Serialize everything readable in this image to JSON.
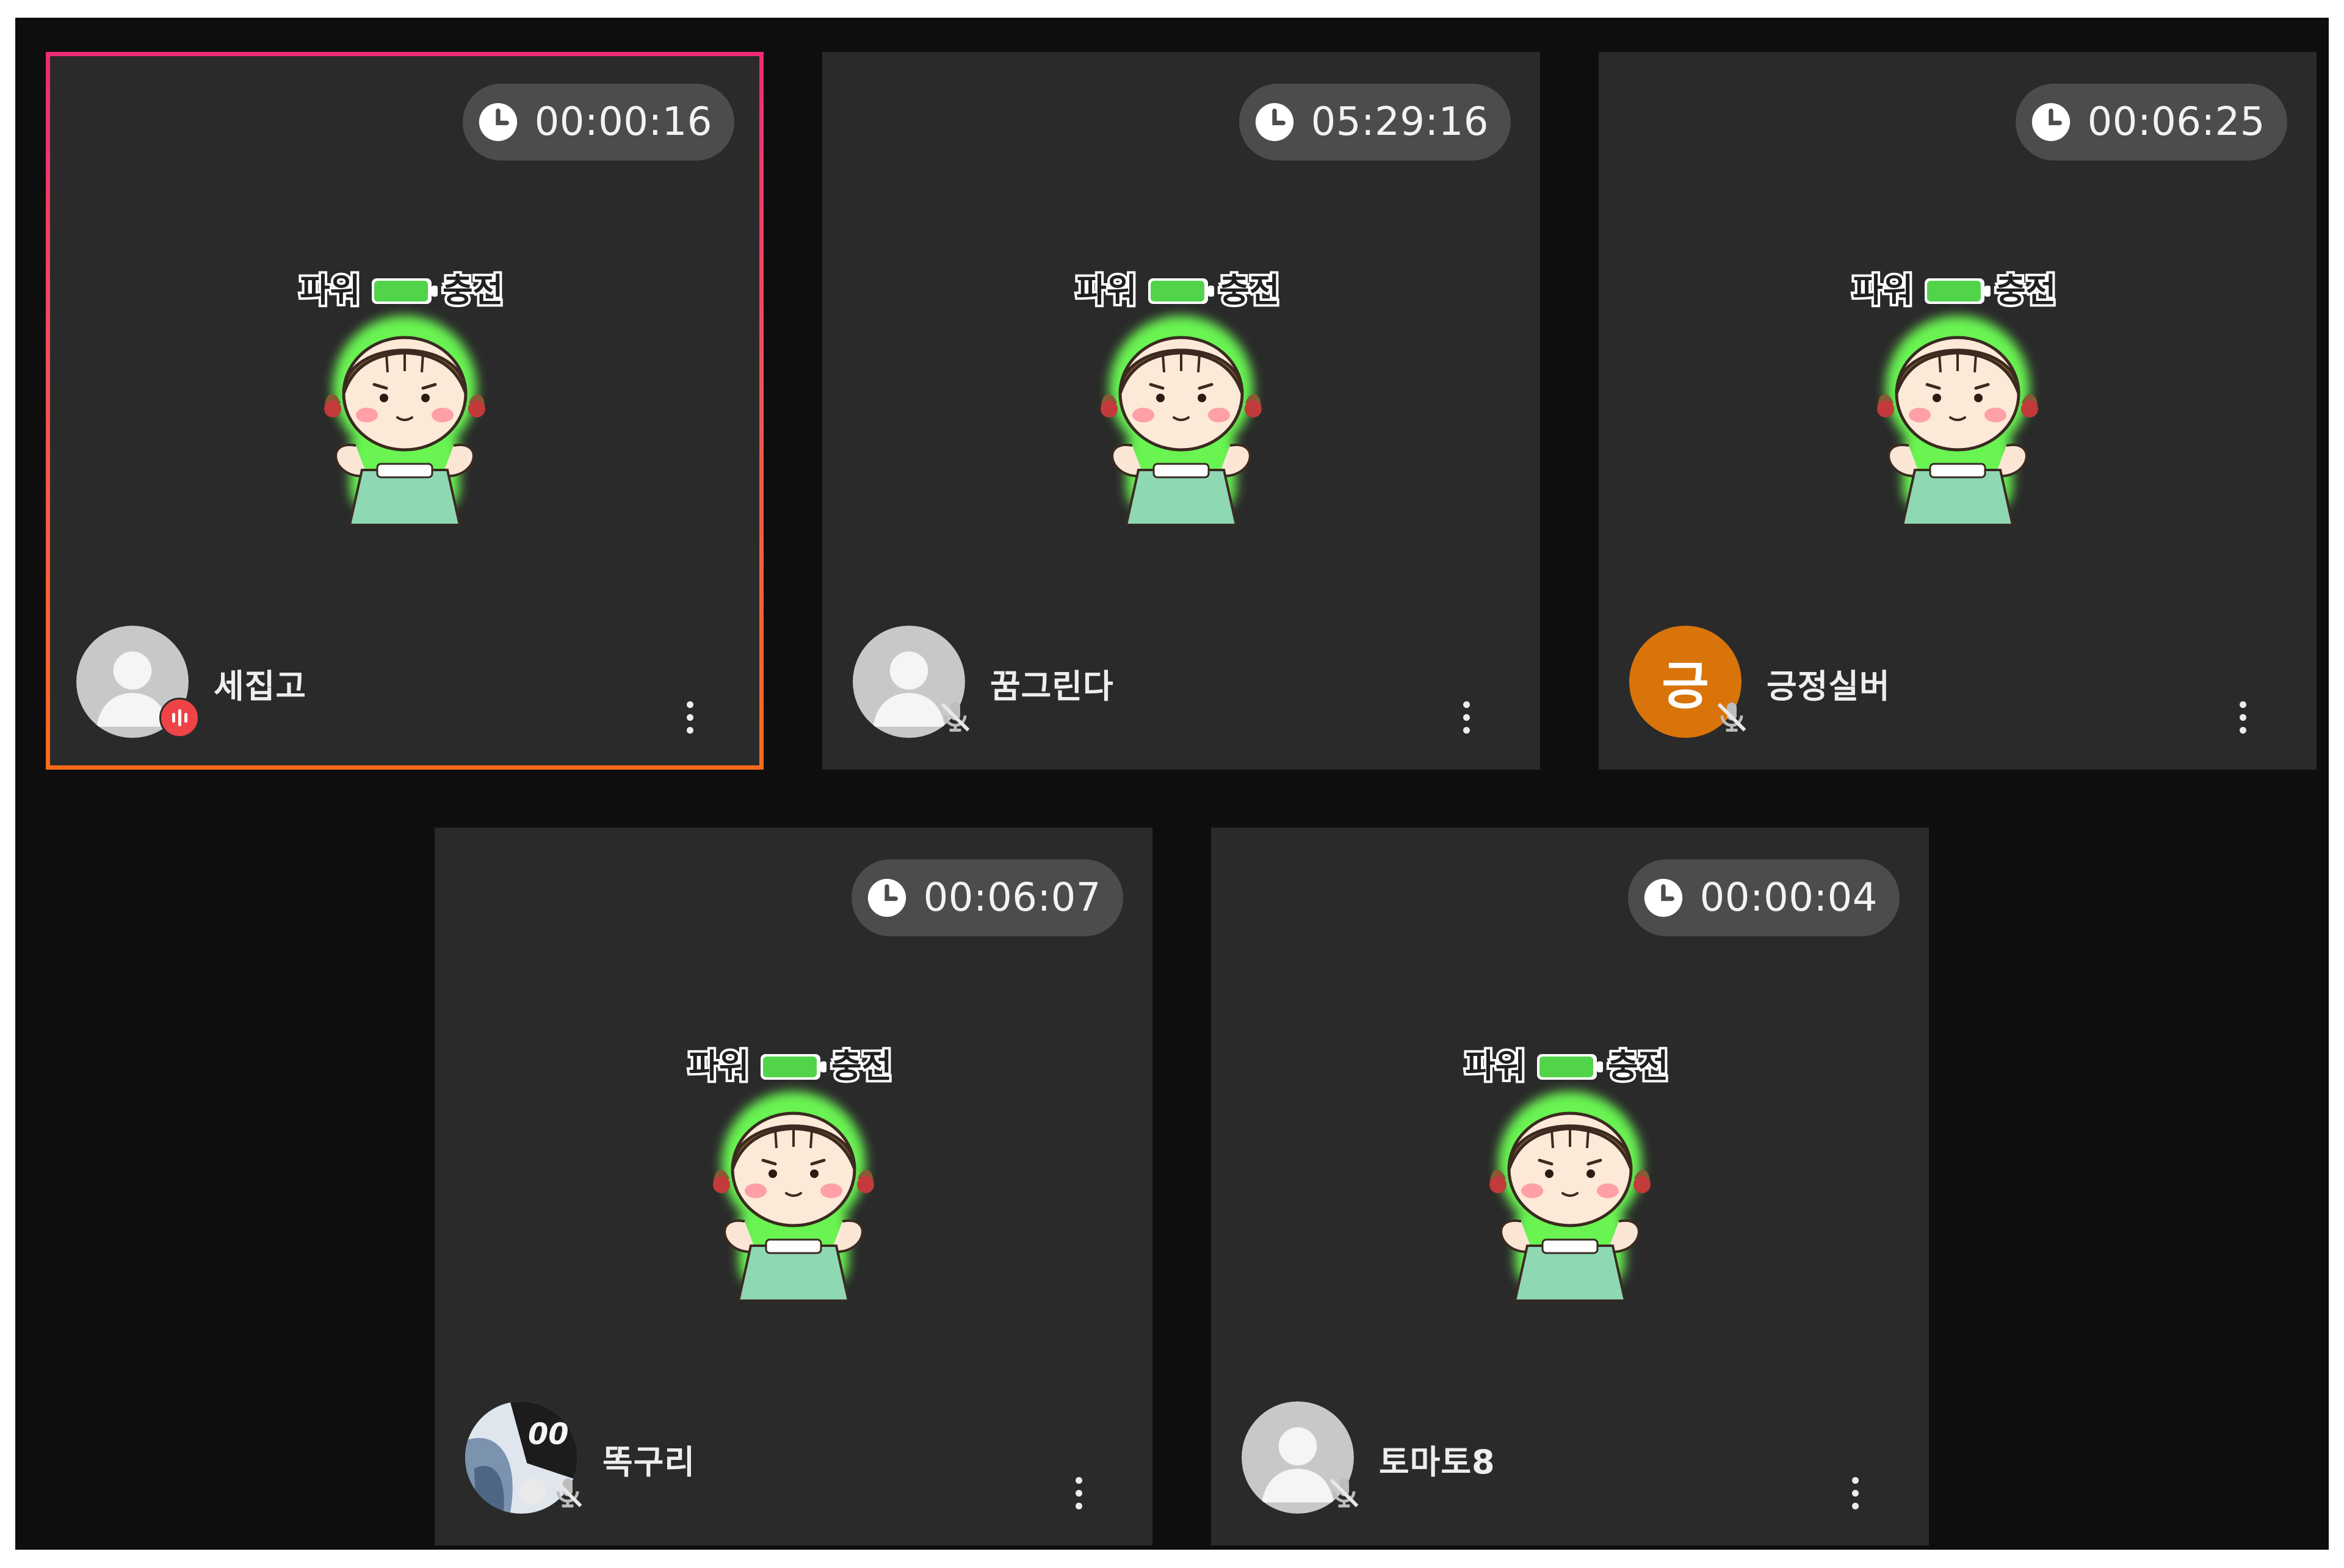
{
  "participants": [
    {
      "name": "세집고",
      "timer": "00:00:16",
      "avatar": "default-avatar",
      "status": "speaking",
      "active": true,
      "sticker_text": "파워 충전"
    },
    {
      "name": "꿈그린다",
      "timer": "05:29:16",
      "avatar": "default-avatar",
      "status": "muted",
      "active": false,
      "sticker_text": "파워 충전"
    },
    {
      "name": "긍정실버",
      "timer": "00:06:25",
      "avatar": "letter",
      "avatar_letter": "긍",
      "avatar_color": "#d9740b",
      "status": "muted",
      "active": false,
      "sticker_text": "파워 충전"
    },
    {
      "name": "똑구리",
      "timer": "00:06:07",
      "avatar": "photo",
      "status": "muted",
      "active": false,
      "sticker_text": "파워 충전"
    },
    {
      "name": "토마토8",
      "timer": "00:00:04",
      "avatar": "default-avatar",
      "status": "muted",
      "active": false,
      "sticker_text": "파워 충전"
    }
  ],
  "icons": {
    "timer": "clock-icon",
    "menu": "more-vertical-icon",
    "muted": "mic-off-icon",
    "speaking": "audio-wave-icon"
  },
  "colors": {
    "background": "#0e0e0e",
    "tile": "#2a2a2a",
    "active_border_top": "#ee2b74",
    "active_border_bottom": "#ff6a1a",
    "timer_pill": "#4c4c4c",
    "speaking_badge": "#ef4347",
    "battery_green": "#52d44a"
  }
}
